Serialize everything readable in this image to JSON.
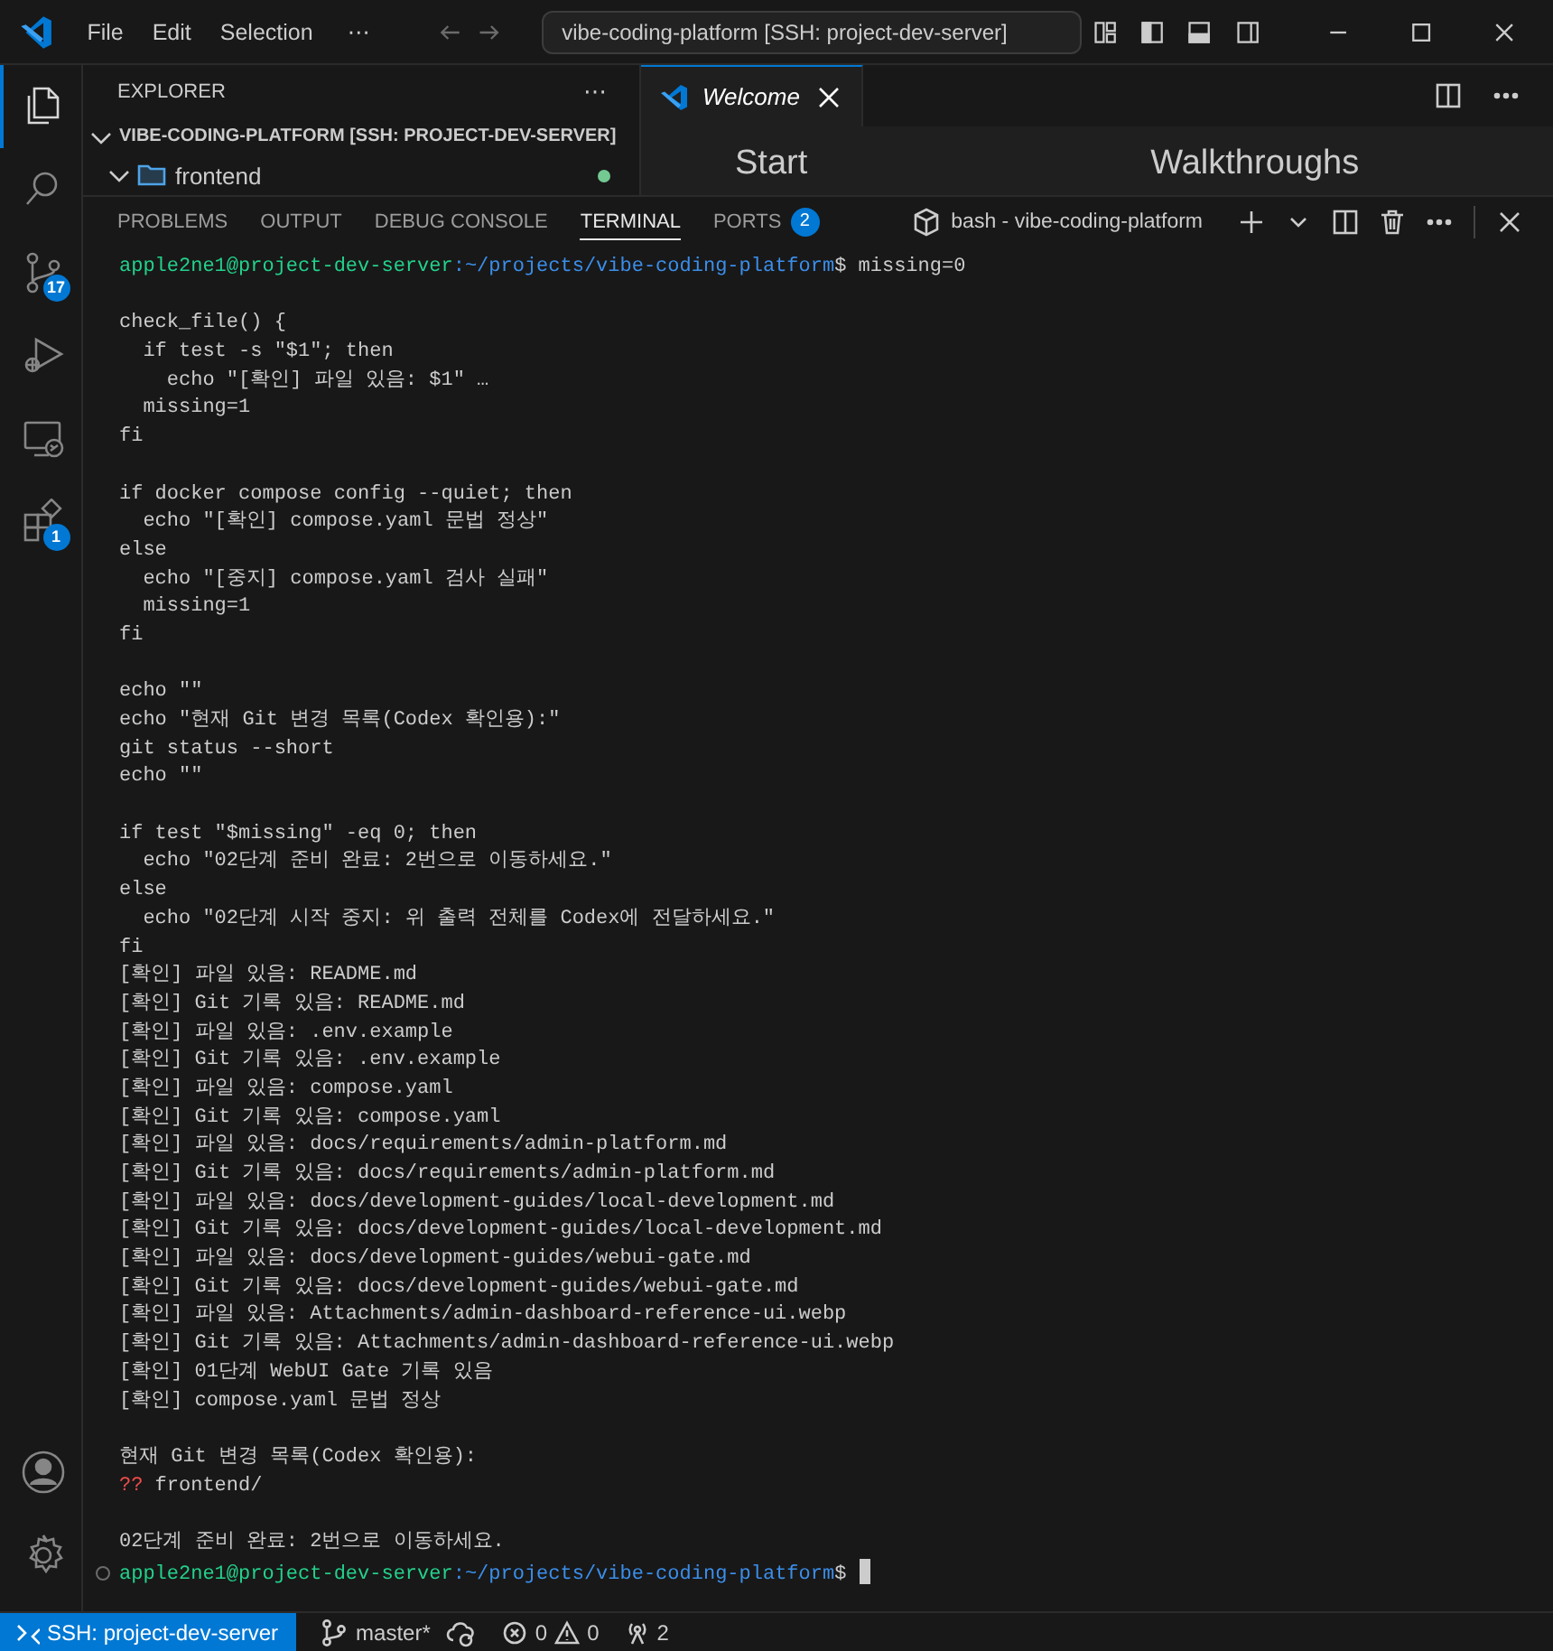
{
  "title_bar": {
    "menus": [
      "File",
      "Edit",
      "Selection"
    ],
    "more": "⋯",
    "command_center": "vibe-coding-platform [SSH: project-dev-server]"
  },
  "activity_bar": {
    "items": [
      {
        "kind": "files",
        "selected": true
      },
      {
        "kind": "search",
        "selected": false
      },
      {
        "kind": "source-control",
        "selected": false,
        "badge": "17"
      },
      {
        "kind": "run-debug",
        "selected": false
      },
      {
        "kind": "remote",
        "selected": false
      },
      {
        "kind": "extensions",
        "selected": false,
        "badge": "1"
      }
    ],
    "bottom_items": [
      {
        "kind": "account"
      },
      {
        "kind": "settings"
      }
    ]
  },
  "sidebar": {
    "title": "EXPLORER",
    "more": "⋯",
    "root": {
      "label": "VIBE-CODING-PLATFORM [SSH: PROJECT-DEV-SERVER]",
      "expanded": true,
      "children": [
        {
          "label": "frontend",
          "expanded": true
        }
      ]
    }
  },
  "editor": {
    "tabs": [
      {
        "label": "Welcome",
        "selected": true
      }
    ],
    "headings": [
      "Start",
      "Walkthroughs"
    ]
  },
  "panel": {
    "tabs": [
      {
        "label": "PROBLEMS",
        "selected": false
      },
      {
        "label": "OUTPUT",
        "selected": false
      },
      {
        "label": "DEBUG CONSOLE",
        "selected": false
      },
      {
        "label": "TERMINAL",
        "selected": true
      },
      {
        "label": "PORTS",
        "selected": false,
        "badge": "2"
      }
    ],
    "terminal_name": "bash - vibe-coding-platform",
    "lines": [
      {
        "kind": "prompt",
        "user": "apple2ne1@project-dev-server",
        "path": ":~/projects/vibe-coding-platform",
        "command": "$ missing=0",
        "cursor": false
      },
      {
        "kind": "blank"
      },
      {
        "kind": "text",
        "text": "check_file() {"
      },
      {
        "kind": "text",
        "text": "  if test -s \"$1\"; then"
      },
      {
        "kind": "text",
        "text": "    echo \"[확인] 파일 있음: $1\" …"
      },
      {
        "kind": "text",
        "text": "  missing=1"
      },
      {
        "kind": "text",
        "text": "fi"
      },
      {
        "kind": "blank"
      },
      {
        "kind": "text",
        "text": "if docker compose config --quiet; then"
      },
      {
        "kind": "text",
        "text": "  echo \"[확인] compose.yaml 문법 정상\""
      },
      {
        "kind": "text",
        "text": "else"
      },
      {
        "kind": "text",
        "text": "  echo \"[중지] compose.yaml 검사 실패\""
      },
      {
        "kind": "text",
        "text": "  missing=1"
      },
      {
        "kind": "text",
        "text": "fi"
      },
      {
        "kind": "blank"
      },
      {
        "kind": "text",
        "text": "echo \"\""
      },
      {
        "kind": "text",
        "text": "echo \"현재 Git 변경 목록(Codex 확인용):\""
      },
      {
        "kind": "text",
        "text": "git status --short"
      },
      {
        "kind": "text",
        "text": "echo \"\""
      },
      {
        "kind": "blank"
      },
      {
        "kind": "text",
        "text": "if test \"$missing\" -eq 0; then"
      },
      {
        "kind": "text",
        "text": "  echo \"02단계 준비 완료: 2번으로 이동하세요.\""
      },
      {
        "kind": "text",
        "text": "else"
      },
      {
        "kind": "text",
        "text": "  echo \"02단계 시작 중지: 위 출력 전체를 Codex에 전달하세요.\""
      },
      {
        "kind": "text",
        "text": "fi"
      },
      {
        "kind": "text",
        "text": "[확인] 파일 있음: README.md"
      },
      {
        "kind": "text",
        "text": "[확인] Git 기록 있음: README.md"
      },
      {
        "kind": "text",
        "text": "[확인] 파일 있음: .env.example"
      },
      {
        "kind": "text",
        "text": "[확인] Git 기록 있음: .env.example"
      },
      {
        "kind": "text",
        "text": "[확인] 파일 있음: compose.yaml"
      },
      {
        "kind": "text",
        "text": "[확인] Git 기록 있음: compose.yaml"
      },
      {
        "kind": "text",
        "text": "[확인] 파일 있음: docs/requirements/admin-platform.md"
      },
      {
        "kind": "text",
        "text": "[확인] Git 기록 있음: docs/requirements/admin-platform.md"
      },
      {
        "kind": "text",
        "text": "[확인] 파일 있음: docs/development-guides/local-development.md"
      },
      {
        "kind": "text",
        "text": "[확인] Git 기록 있음: docs/development-guides/local-development.md"
      },
      {
        "kind": "text",
        "text": "[확인] 파일 있음: docs/development-guides/webui-gate.md"
      },
      {
        "kind": "text",
        "text": "[확인] Git 기록 있음: docs/development-guides/webui-gate.md"
      },
      {
        "kind": "text",
        "text": "[확인] 파일 있음: Attachments/admin-dashboard-reference-ui.webp"
      },
      {
        "kind": "text",
        "text": "[확인] Git 기록 있음: Attachments/admin-dashboard-reference-ui.webp"
      },
      {
        "kind": "text",
        "text": "[확인] 01단계 WebUI Gate 기록 있음"
      },
      {
        "kind": "text",
        "text": "[확인] compose.yaml 문법 정상"
      },
      {
        "kind": "blank"
      },
      {
        "kind": "text",
        "text": "현재 Git 변경 목록(Codex 확인용):"
      },
      {
        "kind": "status",
        "code": "??",
        "path": "frontend/"
      },
      {
        "kind": "blank"
      },
      {
        "kind": "text",
        "text": "02단계 준비 완료: 2번으로 이동하세요."
      },
      {
        "kind": "prompt",
        "user": "apple2ne1@project-dev-server",
        "path": ":~/projects/vibe-coding-platform",
        "command": "$",
        "cursor": true
      }
    ]
  },
  "status_bar": {
    "remote": "SSH: project-dev-server",
    "branch": "master*",
    "errors": "0",
    "warnings": "0",
    "ports": "2"
  }
}
